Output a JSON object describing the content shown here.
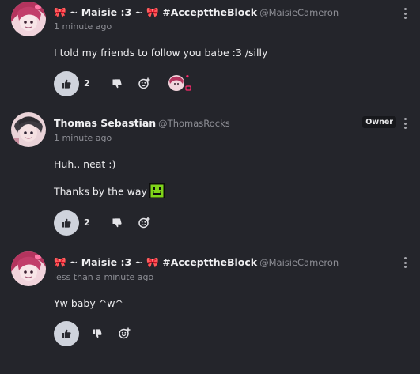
{
  "comments": [
    {
      "display_name": "🎀 ~ Maisie :3 ~ 🎀 #AccepttheBlock",
      "handle": "@MaisieCameron",
      "time": "1 minute ago",
      "lines": [
        "I told my friends to follow you babe :3 /silly"
      ],
      "likes": "2",
      "badge": ""
    },
    {
      "display_name": "Thomas Sebastian",
      "handle": "@ThomasRocks",
      "time": "1 minute ago",
      "lines": [
        "Huh.. neat :)",
        "Thanks by the way"
      ],
      "likes": "2",
      "badge": "Owner"
    },
    {
      "display_name": "🎀 ~ Maisie :3 ~ 🎀 #AccepttheBlock",
      "handle": "@MaisieCameron",
      "time": "less than a minute ago",
      "lines": [
        "Yw baby ^w^"
      ],
      "likes": "",
      "badge": ""
    }
  ],
  "icons": {
    "like": "thumbs-up-icon",
    "dislike": "thumbs-down-icon",
    "react": "add-reaction-icon",
    "menu": "more-vertical-icon",
    "emoji": "green-smiley-emoji"
  },
  "colors": {
    "background": "#24252b",
    "like_button": "#cfd3dc",
    "muted_text": "#8e8f96",
    "owner_badge": "#17181c",
    "emoji_green": "#7fd41a"
  }
}
